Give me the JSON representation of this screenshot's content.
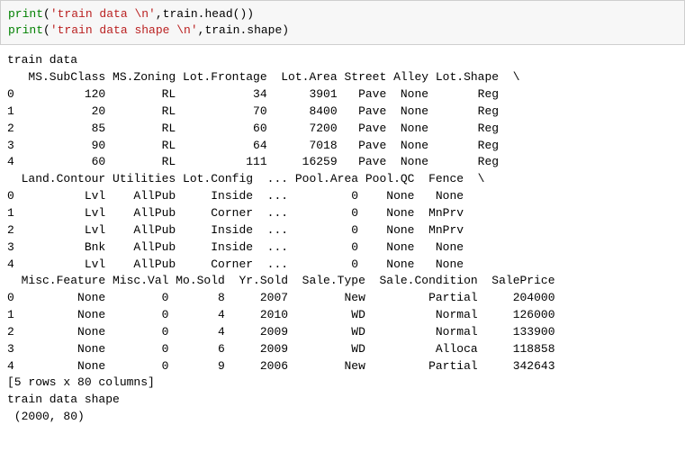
{
  "code": {
    "line1_fn": "print",
    "line1_paren_open": "(",
    "line1_str": "'train data \\n'",
    "line1_rest": ",train.head())",
    "line2_fn": "print",
    "line2_paren_open": "(",
    "line2_str": "'train data shape \\n'",
    "line2_rest": ",train.shape)"
  },
  "output": {
    "title1": "train data ",
    "block1_header": "   MS.SubClass MS.Zoning Lot.Frontage  Lot.Area Street Alley Lot.Shape  \\",
    "block1_rows": [
      "0          120        RL           34      3901   Pave  None       Reg   ",
      "1           20        RL           70      8400   Pave  None       Reg   ",
      "2           85        RL           60      7200   Pave  None       Reg   ",
      "3           90        RL           64      7018   Pave  None       Reg   ",
      "4           60        RL          111     16259   Pave  None       Reg   "
    ],
    "block2_header": "  Land.Contour Utilities Lot.Config  ... Pool.Area Pool.QC  Fence  \\",
    "block2_rows": [
      "0          Lvl    AllPub     Inside  ...         0    None   None   ",
      "1          Lvl    AllPub     Corner  ...         0    None  MnPrv   ",
      "2          Lvl    AllPub     Inside  ...         0    None  MnPrv   ",
      "3          Bnk    AllPub     Inside  ...         0    None   None   ",
      "4          Lvl    AllPub     Corner  ...         0    None   None   "
    ],
    "block3_header": "  Misc.Feature Misc.Val Mo.Sold  Yr.Sold  Sale.Type  Sale.Condition  SalePrice  ",
    "block3_rows": [
      "0         None        0       8     2007        New         Partial     204000  ",
      "1         None        0       4     2010         WD          Normal     126000  ",
      "2         None        0       4     2009         WD          Normal     133900  ",
      "3         None        0       6     2009         WD          Alloca     118858  ",
      "4         None        0       9     2006        New         Partial     342643  "
    ],
    "shape_note": "[5 rows x 80 columns]",
    "title2": "train data shape ",
    "shape_val": " (2000, 80)"
  },
  "chart_data": {
    "type": "table",
    "title": "train.head() — first 5 rows of train DataFrame (5 rows × 80 columns, truncated display)",
    "columns_shown": [
      "MS.SubClass",
      "MS.Zoning",
      "Lot.Frontage",
      "Lot.Area",
      "Street",
      "Alley",
      "Lot.Shape",
      "Land.Contour",
      "Utilities",
      "Lot.Config",
      "Pool.Area",
      "Pool.QC",
      "Fence",
      "Misc.Feature",
      "Misc.Val",
      "Mo.Sold",
      "Yr.Sold",
      "Sale.Type",
      "Sale.Condition",
      "SalePrice"
    ],
    "rows": [
      {
        "index": 0,
        "MS.SubClass": 120,
        "MS.Zoning": "RL",
        "Lot.Frontage": 34,
        "Lot.Area": 3901,
        "Street": "Pave",
        "Alley": "None",
        "Lot.Shape": "Reg",
        "Land.Contour": "Lvl",
        "Utilities": "AllPub",
        "Lot.Config": "Inside",
        "Pool.Area": 0,
        "Pool.QC": "None",
        "Fence": "None",
        "Misc.Feature": "None",
        "Misc.Val": 0,
        "Mo.Sold": 8,
        "Yr.Sold": 2007,
        "Sale.Type": "New",
        "Sale.Condition": "Partial",
        "SalePrice": 204000
      },
      {
        "index": 1,
        "MS.SubClass": 20,
        "MS.Zoning": "RL",
        "Lot.Frontage": 70,
        "Lot.Area": 8400,
        "Street": "Pave",
        "Alley": "None",
        "Lot.Shape": "Reg",
        "Land.Contour": "Lvl",
        "Utilities": "AllPub",
        "Lot.Config": "Corner",
        "Pool.Area": 0,
        "Pool.QC": "None",
        "Fence": "MnPrv",
        "Misc.Feature": "None",
        "Misc.Val": 0,
        "Mo.Sold": 4,
        "Yr.Sold": 2010,
        "Sale.Type": "WD",
        "Sale.Condition": "Normal",
        "SalePrice": 126000
      },
      {
        "index": 2,
        "MS.SubClass": 85,
        "MS.Zoning": "RL",
        "Lot.Frontage": 60,
        "Lot.Area": 7200,
        "Street": "Pave",
        "Alley": "None",
        "Lot.Shape": "Reg",
        "Land.Contour": "Lvl",
        "Utilities": "AllPub",
        "Lot.Config": "Inside",
        "Pool.Area": 0,
        "Pool.QC": "None",
        "Fence": "MnPrv",
        "Misc.Feature": "None",
        "Misc.Val": 0,
        "Mo.Sold": 4,
        "Yr.Sold": 2009,
        "Sale.Type": "WD",
        "Sale.Condition": "Normal",
        "SalePrice": 133900
      },
      {
        "index": 3,
        "MS.SubClass": 90,
        "MS.Zoning": "RL",
        "Lot.Frontage": 64,
        "Lot.Area": 7018,
        "Street": "Pave",
        "Alley": "None",
        "Lot.Shape": "Reg",
        "Land.Contour": "Bnk",
        "Utilities": "AllPub",
        "Lot.Config": "Inside",
        "Pool.Area": 0,
        "Pool.QC": "None",
        "Fence": "None",
        "Misc.Feature": "None",
        "Misc.Val": 0,
        "Mo.Sold": 6,
        "Yr.Sold": 2009,
        "Sale.Type": "WD",
        "Sale.Condition": "Alloca",
        "SalePrice": 118858
      },
      {
        "index": 4,
        "MS.SubClass": 60,
        "MS.Zoning": "RL",
        "Lot.Frontage": 111,
        "Lot.Area": 16259,
        "Street": "Pave",
        "Alley": "None",
        "Lot.Shape": "Reg",
        "Land.Contour": "Lvl",
        "Utilities": "AllPub",
        "Lot.Config": "Corner",
        "Pool.Area": 0,
        "Pool.QC": "None",
        "Fence": "None",
        "Misc.Feature": "None",
        "Misc.Val": 0,
        "Mo.Sold": 9,
        "Yr.Sold": 2006,
        "Sale.Type": "New",
        "Sale.Condition": "Partial",
        "SalePrice": 342643
      }
    ],
    "shape": [
      2000,
      80
    ]
  }
}
